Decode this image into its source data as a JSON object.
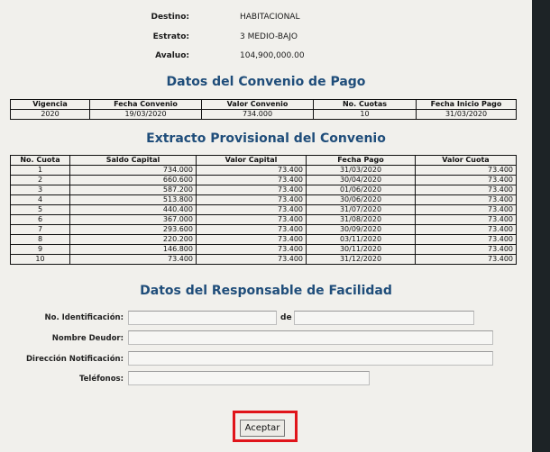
{
  "header_info": [
    {
      "label": "Destino:",
      "value": "HABITACIONAL"
    },
    {
      "label": "Estrato:",
      "value": "3 MEDIO-BAJO"
    },
    {
      "label": "Avaluo:",
      "value": "104,900,000.00"
    }
  ],
  "convenio": {
    "title": "Datos del Convenio de Pago",
    "headers": [
      "Vigencia",
      "Fecha Convenio",
      "Valor Convenio",
      "No. Cuotas",
      "Fecha Inicio Pago"
    ],
    "row": [
      "2020",
      "19/03/2020",
      "734.000",
      "10",
      "31/03/2020"
    ]
  },
  "extracto": {
    "title": "Extracto Provisional del Convenio",
    "headers": [
      "No. Cuota",
      "Saldo Capital",
      "Valor Capital",
      "Fecha Pago",
      "Valor Cuota"
    ],
    "rows": [
      [
        "1",
        "734.000",
        "73.400",
        "31/03/2020",
        "73.400"
      ],
      [
        "2",
        "660.600",
        "73.400",
        "30/04/2020",
        "73.400"
      ],
      [
        "3",
        "587.200",
        "73.400",
        "01/06/2020",
        "73.400"
      ],
      [
        "4",
        "513.800",
        "73.400",
        "30/06/2020",
        "73.400"
      ],
      [
        "5",
        "440.400",
        "73.400",
        "31/07/2020",
        "73.400"
      ],
      [
        "6",
        "367.000",
        "73.400",
        "31/08/2020",
        "73.400"
      ],
      [
        "7",
        "293.600",
        "73.400",
        "30/09/2020",
        "73.400"
      ],
      [
        "8",
        "220.200",
        "73.400",
        "03/11/2020",
        "73.400"
      ],
      [
        "9",
        "146.800",
        "73.400",
        "30/11/2020",
        "73.400"
      ],
      [
        "10",
        "73.400",
        "73.400",
        "31/12/2020",
        "73.400"
      ]
    ]
  },
  "responsable": {
    "title": "Datos del Responsable de Facilidad",
    "id_label": "No. Identificación:",
    "de_label": "de",
    "deudor_label": "Nombre Deudor:",
    "direccion_label": "Dirección Notificación:",
    "telefonos_label": "Teléfonos:",
    "id_value": "",
    "id_de_value": "",
    "deudor_value": "",
    "direccion_value": "",
    "telefonos_value": ""
  },
  "accept_button": "Aceptar",
  "colors": {
    "title_blue": "#1f4d7a",
    "highlight_red": "#e0151b"
  }
}
